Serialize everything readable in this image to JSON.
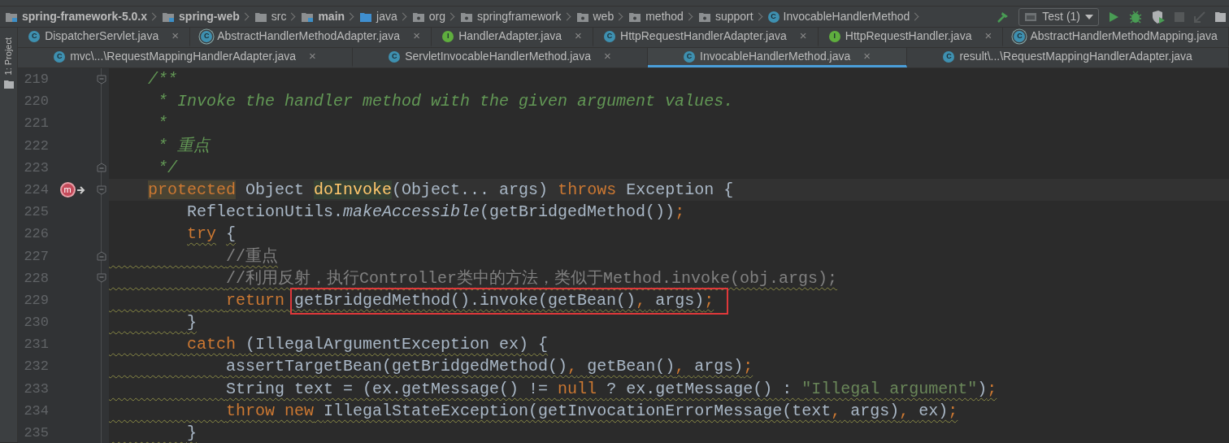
{
  "breadcrumbs": [
    {
      "label": "spring-framework-5.0.x",
      "kind": "module"
    },
    {
      "label": "spring-web",
      "kind": "module"
    },
    {
      "label": "src",
      "kind": "folder"
    },
    {
      "label": "main",
      "kind": "module"
    },
    {
      "label": "java",
      "kind": "source"
    },
    {
      "label": "org",
      "kind": "package"
    },
    {
      "label": "springframework",
      "kind": "package"
    },
    {
      "label": "web",
      "kind": "package"
    },
    {
      "label": "method",
      "kind": "package"
    },
    {
      "label": "support",
      "kind": "package"
    },
    {
      "label": "InvocableHandlerMethod",
      "kind": "class",
      "icon_letter": "C"
    }
  ],
  "toolbar": {
    "run_config": "Test (1)",
    "buttons": [
      {
        "kind": "build",
        "disabled": false
      },
      {
        "kind": "run",
        "disabled": false
      },
      {
        "kind": "debug",
        "disabled": false
      },
      {
        "kind": "coverage",
        "disabled": false
      },
      {
        "kind": "stop",
        "disabled": true
      },
      {
        "kind": "rollback",
        "disabled": true
      }
    ]
  },
  "tool_window_strip": {
    "label": "1: Project"
  },
  "tab_rows": [
    [
      {
        "label": "DispatcherServlet.java",
        "kind": "class",
        "icon_letter": "C",
        "close": "×",
        "selected": false
      },
      {
        "label": "AbstractHandlerMethodAdapter.java",
        "kind": "abstract",
        "icon_letter": "C",
        "close": "×",
        "selected": false
      },
      {
        "label": "HandlerAdapter.java",
        "kind": "interface",
        "icon_letter": "I",
        "close": "×",
        "selected": false
      },
      {
        "label": "HttpRequestHandlerAdapter.java",
        "kind": "class",
        "icon_letter": "C",
        "close": "×",
        "selected": false
      },
      {
        "label": "HttpRequestHandler.java",
        "kind": "interface",
        "icon_letter": "I",
        "close": "×",
        "selected": false
      },
      {
        "label": "AbstractHandlerMethodMapping.java",
        "kind": "abstract",
        "icon_letter": "C",
        "selected": false
      }
    ],
    [
      {
        "label": "mvc\\...\\RequestMappingHandlerAdapter.java",
        "kind": "class",
        "icon_letter": "C",
        "close": "×",
        "selected": false
      },
      {
        "label": "ServletInvocableHandlerMethod.java",
        "kind": "class",
        "icon_letter": "C",
        "close": "×",
        "selected": false
      },
      {
        "label": "InvocableHandlerMethod.java",
        "kind": "class",
        "icon_letter": "C",
        "close": "×",
        "selected": true
      },
      {
        "label": "result\\...\\RequestMappingHandlerAdapter.java",
        "kind": "class",
        "icon_letter": "C",
        "selected": false
      }
    ]
  ],
  "lines": [
    {
      "number": "219",
      "fold_start": true,
      "segments": [
        {
          "kind": "doc",
          "text": "    /**"
        }
      ]
    },
    {
      "number": "220",
      "segments": [
        {
          "kind": "doc",
          "text": "     * Invoke the handler method with the given argument values."
        }
      ]
    },
    {
      "number": "221",
      "segments": [
        {
          "kind": "doc",
          "text": "     *"
        }
      ]
    },
    {
      "number": "222",
      "segments": [
        {
          "kind": "doc",
          "text": "     * 重点"
        }
      ]
    },
    {
      "number": "223",
      "fold_end": true,
      "segments": [
        {
          "kind": "doc",
          "text": "     */"
        }
      ]
    },
    {
      "number": "224",
      "fold_start": true,
      "current": true,
      "gutter_mark": "m",
      "segments": [
        {
          "kind": "keyword",
          "text": "    protected",
          "marked": true
        },
        {
          "kind": "plain",
          "text": " Object "
        },
        {
          "kind": "declaration",
          "text": "doInvoke",
          "marked": true
        },
        {
          "kind": "plain",
          "text": "(Object... args) "
        },
        {
          "kind": "keyword",
          "text": "throws"
        },
        {
          "kind": "plain",
          "text": " Exception {"
        }
      ]
    },
    {
      "number": "225",
      "segments": [
        {
          "kind": "plain",
          "text": "        ReflectionUtils."
        },
        {
          "kind": "static",
          "text": "makeAccessible"
        },
        {
          "kind": "plain",
          "text": "(getBridgedMethod())"
        },
        {
          "kind": "keyword",
          "text": ";"
        }
      ]
    },
    {
      "number": "226",
      "segments": [
        {
          "kind": "keyword",
          "text": "        try",
          "warning": true
        },
        {
          "kind": "plain",
          "text": " {",
          "warning": true
        }
      ]
    },
    {
      "number": "227",
      "fold_end": true,
      "warning": true,
      "segments": [
        {
          "kind": "comment",
          "text": "            //重点"
        }
      ]
    },
    {
      "number": "228",
      "fold_start": true,
      "warning": true,
      "segments": [
        {
          "kind": "comment",
          "text": "            //利用反射，执行Controller类中的方法，类似于Method.invoke(obj.args);"
        }
      ]
    },
    {
      "number": "229",
      "warning": true,
      "segments": [
        {
          "kind": "keyword",
          "text": "            return "
        },
        {
          "kind": "box",
          "outlined": true,
          "segments": [
            {
              "kind": "plain",
              "text": "getBridgedMethod().invoke(getBean()"
            },
            {
              "kind": "keyword",
              "text": ","
            },
            {
              "kind": "plain",
              "text": " args)"
            },
            {
              "kind": "keyword",
              "text": ";"
            }
          ]
        }
      ]
    },
    {
      "number": "230",
      "warning": true,
      "segments": [
        {
          "kind": "plain",
          "text": "        }"
        }
      ]
    },
    {
      "number": "231",
      "warning": true,
      "segments": [
        {
          "kind": "keyword",
          "text": "        catch"
        },
        {
          "kind": "plain",
          "text": " (IllegalArgumentException ex) {"
        }
      ]
    },
    {
      "number": "232",
      "warning": true,
      "segments": [
        {
          "kind": "plain",
          "text": "            assertTargetBean(getBridgedMethod()"
        },
        {
          "kind": "keyword",
          "text": ","
        },
        {
          "kind": "plain",
          "text": " getBean()"
        },
        {
          "kind": "keyword",
          "text": ","
        },
        {
          "kind": "plain",
          "text": " args)"
        },
        {
          "kind": "keyword",
          "text": ";"
        }
      ]
    },
    {
      "number": "233",
      "warning": true,
      "segments": [
        {
          "kind": "plain",
          "text": "            String text = (ex.getMessage() != "
        },
        {
          "kind": "keyword",
          "text": "null"
        },
        {
          "kind": "plain",
          "text": " ? ex.getMessage() : "
        },
        {
          "kind": "string",
          "text": "\"Illegal argument\""
        },
        {
          "kind": "plain",
          "text": ")"
        },
        {
          "kind": "keyword",
          "text": ";"
        }
      ]
    },
    {
      "number": "234",
      "warning": true,
      "segments": [
        {
          "kind": "keyword",
          "text": "            throw new"
        },
        {
          "kind": "plain",
          "text": " IllegalStateException(getInvocationErrorMessage(text"
        },
        {
          "kind": "keyword",
          "text": ","
        },
        {
          "kind": "plain",
          "text": " args)"
        },
        {
          "kind": "keyword",
          "text": ","
        },
        {
          "kind": "plain",
          "text": " ex)"
        },
        {
          "kind": "keyword",
          "text": ";"
        }
      ]
    },
    {
      "number": "235",
      "warning": true,
      "segments": [
        {
          "kind": "plain",
          "text": "        }"
        }
      ]
    }
  ]
}
